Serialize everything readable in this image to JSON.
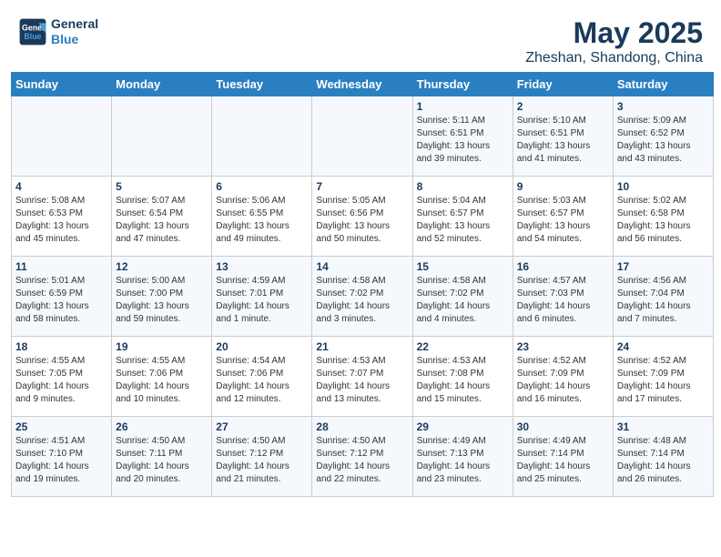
{
  "header": {
    "logo_line1": "General",
    "logo_line2": "Blue",
    "month": "May 2025",
    "location": "Zheshan, Shandong, China"
  },
  "weekdays": [
    "Sunday",
    "Monday",
    "Tuesday",
    "Wednesday",
    "Thursday",
    "Friday",
    "Saturday"
  ],
  "weeks": [
    [
      {
        "day": "",
        "info": ""
      },
      {
        "day": "",
        "info": ""
      },
      {
        "day": "",
        "info": ""
      },
      {
        "day": "",
        "info": ""
      },
      {
        "day": "1",
        "info": "Sunrise: 5:11 AM\nSunset: 6:51 PM\nDaylight: 13 hours\nand 39 minutes."
      },
      {
        "day": "2",
        "info": "Sunrise: 5:10 AM\nSunset: 6:51 PM\nDaylight: 13 hours\nand 41 minutes."
      },
      {
        "day": "3",
        "info": "Sunrise: 5:09 AM\nSunset: 6:52 PM\nDaylight: 13 hours\nand 43 minutes."
      }
    ],
    [
      {
        "day": "4",
        "info": "Sunrise: 5:08 AM\nSunset: 6:53 PM\nDaylight: 13 hours\nand 45 minutes."
      },
      {
        "day": "5",
        "info": "Sunrise: 5:07 AM\nSunset: 6:54 PM\nDaylight: 13 hours\nand 47 minutes."
      },
      {
        "day": "6",
        "info": "Sunrise: 5:06 AM\nSunset: 6:55 PM\nDaylight: 13 hours\nand 49 minutes."
      },
      {
        "day": "7",
        "info": "Sunrise: 5:05 AM\nSunset: 6:56 PM\nDaylight: 13 hours\nand 50 minutes."
      },
      {
        "day": "8",
        "info": "Sunrise: 5:04 AM\nSunset: 6:57 PM\nDaylight: 13 hours\nand 52 minutes."
      },
      {
        "day": "9",
        "info": "Sunrise: 5:03 AM\nSunset: 6:57 PM\nDaylight: 13 hours\nand 54 minutes."
      },
      {
        "day": "10",
        "info": "Sunrise: 5:02 AM\nSunset: 6:58 PM\nDaylight: 13 hours\nand 56 minutes."
      }
    ],
    [
      {
        "day": "11",
        "info": "Sunrise: 5:01 AM\nSunset: 6:59 PM\nDaylight: 13 hours\nand 58 minutes."
      },
      {
        "day": "12",
        "info": "Sunrise: 5:00 AM\nSunset: 7:00 PM\nDaylight: 13 hours\nand 59 minutes."
      },
      {
        "day": "13",
        "info": "Sunrise: 4:59 AM\nSunset: 7:01 PM\nDaylight: 14 hours\nand 1 minute."
      },
      {
        "day": "14",
        "info": "Sunrise: 4:58 AM\nSunset: 7:02 PM\nDaylight: 14 hours\nand 3 minutes."
      },
      {
        "day": "15",
        "info": "Sunrise: 4:58 AM\nSunset: 7:02 PM\nDaylight: 14 hours\nand 4 minutes."
      },
      {
        "day": "16",
        "info": "Sunrise: 4:57 AM\nSunset: 7:03 PM\nDaylight: 14 hours\nand 6 minutes."
      },
      {
        "day": "17",
        "info": "Sunrise: 4:56 AM\nSunset: 7:04 PM\nDaylight: 14 hours\nand 7 minutes."
      }
    ],
    [
      {
        "day": "18",
        "info": "Sunrise: 4:55 AM\nSunset: 7:05 PM\nDaylight: 14 hours\nand 9 minutes."
      },
      {
        "day": "19",
        "info": "Sunrise: 4:55 AM\nSunset: 7:06 PM\nDaylight: 14 hours\nand 10 minutes."
      },
      {
        "day": "20",
        "info": "Sunrise: 4:54 AM\nSunset: 7:06 PM\nDaylight: 14 hours\nand 12 minutes."
      },
      {
        "day": "21",
        "info": "Sunrise: 4:53 AM\nSunset: 7:07 PM\nDaylight: 14 hours\nand 13 minutes."
      },
      {
        "day": "22",
        "info": "Sunrise: 4:53 AM\nSunset: 7:08 PM\nDaylight: 14 hours\nand 15 minutes."
      },
      {
        "day": "23",
        "info": "Sunrise: 4:52 AM\nSunset: 7:09 PM\nDaylight: 14 hours\nand 16 minutes."
      },
      {
        "day": "24",
        "info": "Sunrise: 4:52 AM\nSunset: 7:09 PM\nDaylight: 14 hours\nand 17 minutes."
      }
    ],
    [
      {
        "day": "25",
        "info": "Sunrise: 4:51 AM\nSunset: 7:10 PM\nDaylight: 14 hours\nand 19 minutes."
      },
      {
        "day": "26",
        "info": "Sunrise: 4:50 AM\nSunset: 7:11 PM\nDaylight: 14 hours\nand 20 minutes."
      },
      {
        "day": "27",
        "info": "Sunrise: 4:50 AM\nSunset: 7:12 PM\nDaylight: 14 hours\nand 21 minutes."
      },
      {
        "day": "28",
        "info": "Sunrise: 4:50 AM\nSunset: 7:12 PM\nDaylight: 14 hours\nand 22 minutes."
      },
      {
        "day": "29",
        "info": "Sunrise: 4:49 AM\nSunset: 7:13 PM\nDaylight: 14 hours\nand 23 minutes."
      },
      {
        "day": "30",
        "info": "Sunrise: 4:49 AM\nSunset: 7:14 PM\nDaylight: 14 hours\nand 25 minutes."
      },
      {
        "day": "31",
        "info": "Sunrise: 4:48 AM\nSunset: 7:14 PM\nDaylight: 14 hours\nand 26 minutes."
      }
    ]
  ]
}
